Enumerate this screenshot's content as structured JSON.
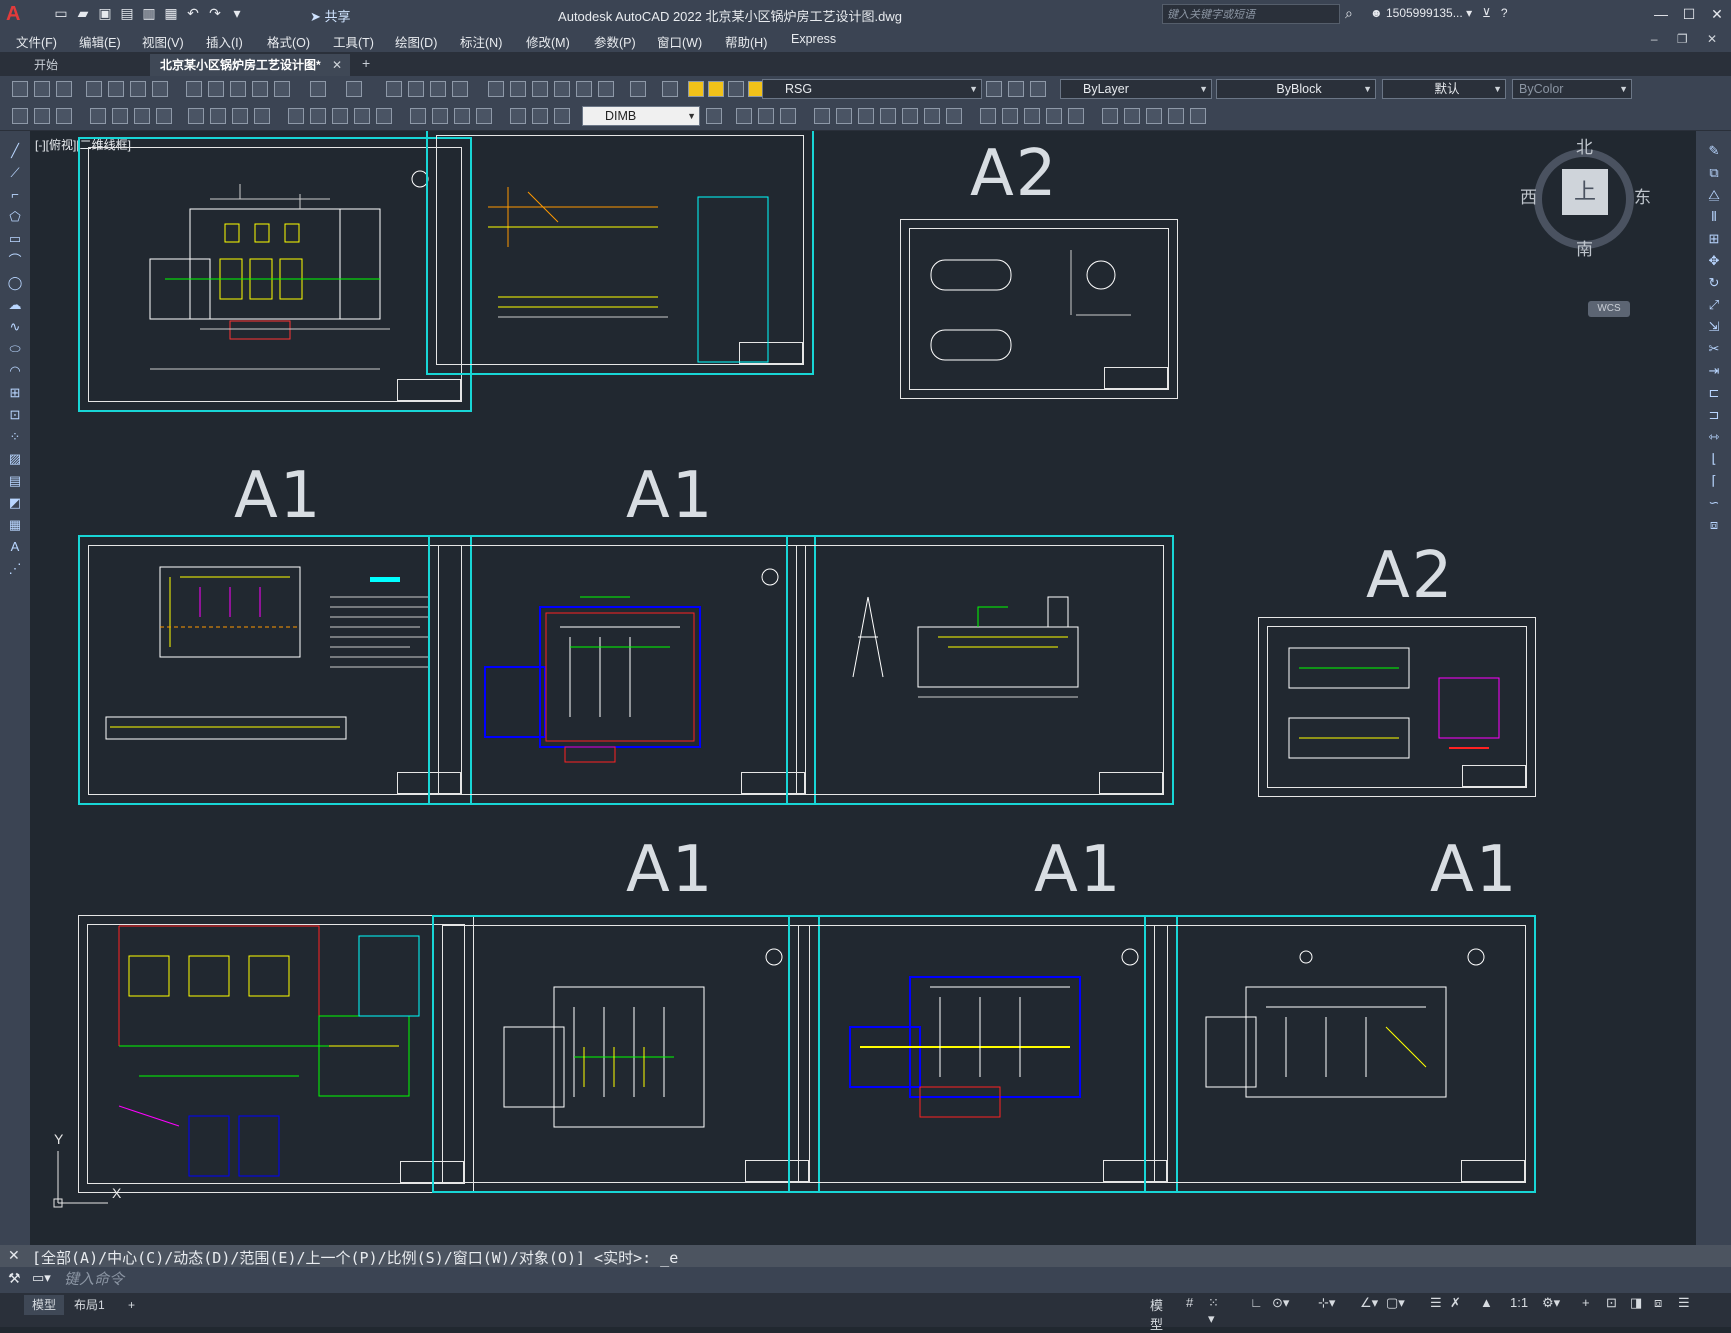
{
  "app": {
    "logo": "A",
    "window_title": "Autodesk AutoCAD 2022    北京某小区锅炉房工艺设计图.dwg",
    "share_label": "共享",
    "search_placeholder": "键入关键字或短语",
    "user_id": "1505999135...",
    "qat_icons": [
      "new-icon",
      "open-icon",
      "save-icon",
      "saveas-icon",
      "publish-icon",
      "print-icon",
      "undo-icon",
      "redo-icon"
    ]
  },
  "menu": [
    "文件(F)",
    "编辑(E)",
    "视图(V)",
    "插入(I)",
    "格式(O)",
    "工具(T)",
    "绘图(D)",
    "标注(N)",
    "修改(M)",
    "参数(P)",
    "窗口(W)",
    "帮助(H)",
    "Express"
  ],
  "tabs": {
    "start": "开始",
    "active": "北京某小区锅炉房工艺设计图*",
    "close": "✕",
    "add": "+"
  },
  "toolbar": {
    "layer": "RSG",
    "color": "ByLayer",
    "linetype": "ByBlock",
    "lineweight": "默认",
    "plotstyle": "ByColor",
    "dimstyle": "DIMB"
  },
  "viewport_label": "[-][俯视][二维线框]",
  "sheet_size_labels": [
    "A2",
    "A1",
    "A1",
    "A2",
    "A1",
    "A1",
    "A1"
  ],
  "viewcube": {
    "top": "北",
    "bottom": "南",
    "left": "西",
    "right": "东",
    "face": "上",
    "wcs": "WCS"
  },
  "ucs": {
    "y": "Y",
    "x": "X"
  },
  "command": {
    "history": "[全部(A)/中心(C)/动态(D)/范围(E)/上一个(P)/比例(S)/窗口(W)/对象(O)] <实时>: _e",
    "placeholder": "键入命令"
  },
  "status": {
    "model_tab": "模型",
    "layout_tab": "布局1",
    "add": "+",
    "model_btn": "模型",
    "scale": "1:1"
  }
}
